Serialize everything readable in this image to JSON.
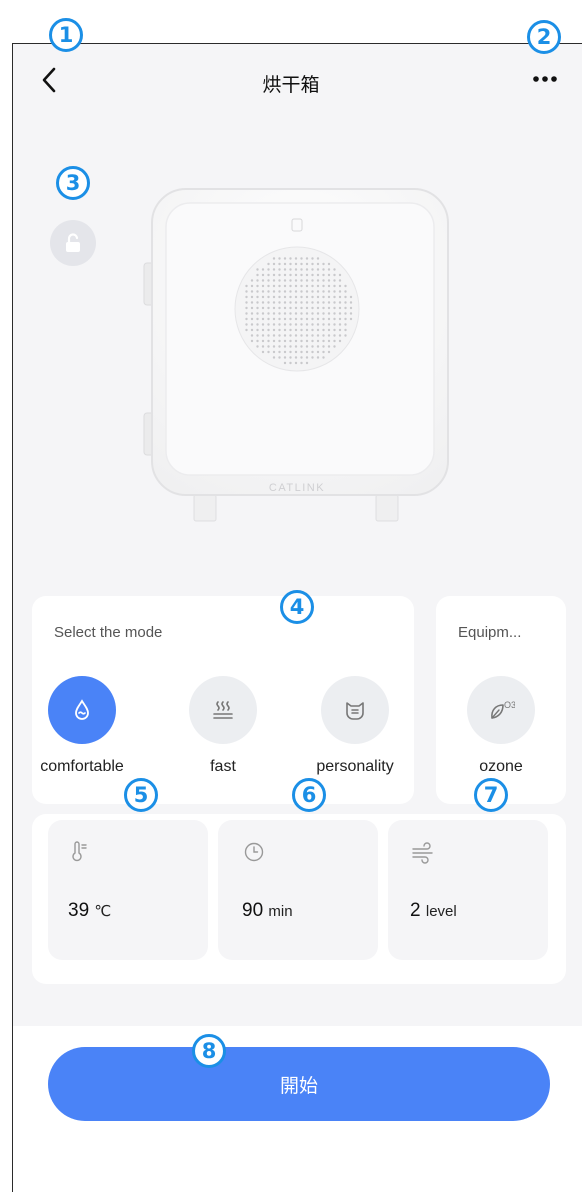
{
  "header": {
    "title": "烘干箱",
    "back_icon": "chevron-left-icon",
    "more_icon": "more-horizontal-icon"
  },
  "lock": {
    "icon": "unlock-icon"
  },
  "device": {
    "brand_label": "CATLINK"
  },
  "mode_card": {
    "label": "Select the mode",
    "modes": [
      {
        "label": "comfortable",
        "icon": "water-drop-icon",
        "selected": true
      },
      {
        "label": "fast",
        "icon": "heat-waves-icon",
        "selected": false
      },
      {
        "label": "personality",
        "icon": "cat-face-icon",
        "selected": false
      }
    ]
  },
  "equipment_card": {
    "label": "Equipm...",
    "items": [
      {
        "label": "ozone",
        "icon": "ozone-leaf-icon",
        "icon_text": "O3"
      }
    ]
  },
  "params": [
    {
      "value": "39",
      "unit": "℃",
      "icon": "thermometer-icon"
    },
    {
      "value": "90",
      "unit": "min",
      "icon": "clock-icon"
    },
    {
      "value": "2",
      "unit": "level",
      "icon": "wind-icon"
    }
  ],
  "start_button": {
    "label": "開始"
  },
  "annotations": [
    "1",
    "2",
    "3",
    "4",
    "5",
    "6",
    "7",
    "8"
  ],
  "colors": {
    "accent": "#4a83f7",
    "badge": "#1b8fe6",
    "background": "#f5f5f7"
  }
}
